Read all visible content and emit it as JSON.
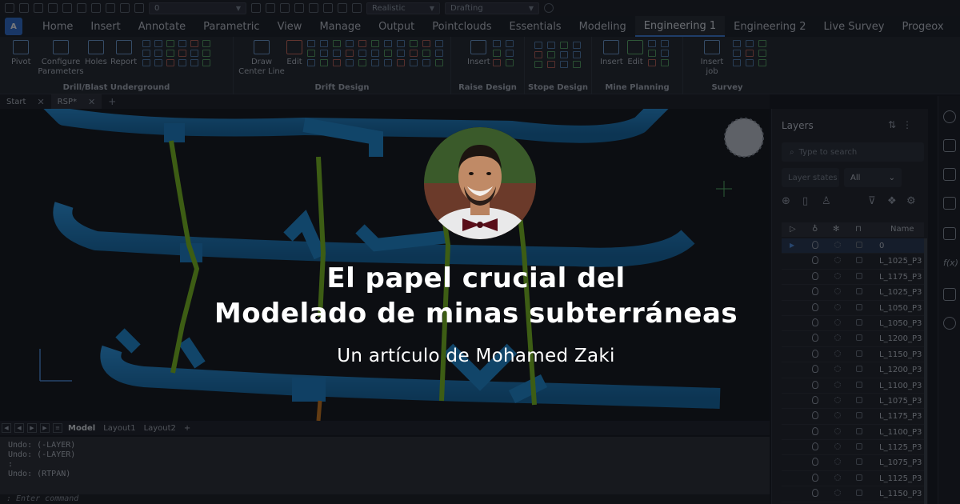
{
  "quick_access": {
    "layer_value": "0",
    "visual_style": "Realistic",
    "workspace": "Drafting"
  },
  "ribbon_tabs": [
    {
      "label": "Home"
    },
    {
      "label": "Insert"
    },
    {
      "label": "Annotate"
    },
    {
      "label": "Parametric"
    },
    {
      "label": "View"
    },
    {
      "label": "Manage"
    },
    {
      "label": "Output"
    },
    {
      "label": "Pointclouds"
    },
    {
      "label": "Essentials"
    },
    {
      "label": "Modeling"
    },
    {
      "label": "Engineering 1"
    },
    {
      "label": "Engineering 2"
    },
    {
      "label": "Live Survey"
    },
    {
      "label": "Progeox"
    }
  ],
  "ribbon_groups": {
    "drill_blast": {
      "title": "Drill/Blast Underground",
      "pivot": "Pivot",
      "configure": "Configure Parameters",
      "holes": "Holes",
      "report": "Report"
    },
    "drift": {
      "title": "Drift Design",
      "draw_center": "Draw Center Line",
      "edit": "Edit"
    },
    "raise": {
      "title": "Raise Design",
      "insert": "Insert"
    },
    "stope": {
      "title": "Stope Design"
    },
    "mine_planning": {
      "title": "Mine Planning",
      "insert": "Insert",
      "edit": "Edit"
    },
    "survey": {
      "title": "Survey",
      "insert_job": "Insert job"
    }
  },
  "doc_tabs": {
    "start": "Start",
    "active": "RSP*",
    "close": "✕",
    "add": "+"
  },
  "layout_tabs": {
    "model": "Model",
    "layout1": "Layout1",
    "layout2": "Layout2",
    "add": "+"
  },
  "command_history": [
    "Undo: (-LAYER)",
    "Undo: (-LAYER)",
    ":",
    "Undo: (RTPAN)"
  ],
  "command_prompt": ": Enter command",
  "layers_panel": {
    "title": "Layers",
    "search_placeholder": "Type to search",
    "layer_states": "Layer states",
    "filter": "All",
    "column_name": "Name",
    "rows": [
      {
        "name": "0"
      },
      {
        "name": "L_1025_P3"
      },
      {
        "name": "L_1175_P3"
      },
      {
        "name": "L_1025_P3"
      },
      {
        "name": "L_1050_P3"
      },
      {
        "name": "L_1050_P3"
      },
      {
        "name": "L_1200_P3"
      },
      {
        "name": "L_1150_P3"
      },
      {
        "name": "L_1200_P3"
      },
      {
        "name": "L_1100_P3"
      },
      {
        "name": "L_1075_P3"
      },
      {
        "name": "L_1175_P3"
      },
      {
        "name": "L_1100_P3"
      },
      {
        "name": "L_1125_P3"
      },
      {
        "name": "L_1075_P3"
      },
      {
        "name": "L_1125_P3"
      },
      {
        "name": "L_1150_P3"
      }
    ]
  },
  "headline": {
    "line1": "El papel crucial del",
    "line2": "Modelado de minas subterráneas",
    "byline": "Un artículo de Mohamed Zaki"
  },
  "colors": {
    "tunnel_blue": "#1e8fd8",
    "raise_green": "#7fc31c",
    "accent": "#3d7dd8"
  }
}
